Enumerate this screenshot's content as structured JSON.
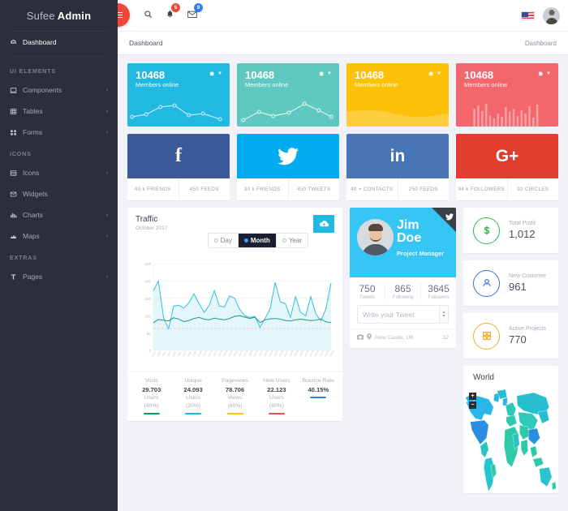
{
  "brand": {
    "light": "Sufee",
    "bold": "Admin"
  },
  "topbar": {
    "search_icon": "search-icon",
    "bell_badge": "5",
    "mail_badge": "9"
  },
  "breadcrumb": {
    "title": "Dashboard",
    "right": "Dashboard"
  },
  "sidebar": {
    "items": [
      {
        "label": "Dashboard",
        "icon": "dashboard-icon",
        "caret": "",
        "active": true
      }
    ],
    "sections": [
      {
        "heading": "UI ELEMENTS",
        "items": [
          {
            "label": "Components",
            "icon": "components-icon",
            "caret": "›"
          },
          {
            "label": "Tables",
            "icon": "tables-icon",
            "caret": "›"
          },
          {
            "label": "Forms",
            "icon": "forms-icon",
            "caret": "›"
          }
        ]
      },
      {
        "heading": "ICONS",
        "items": [
          {
            "label": "Icons",
            "icon": "icons-icon",
            "caret": "›"
          },
          {
            "label": "Widgets",
            "icon": "widgets-icon",
            "caret": ""
          },
          {
            "label": "Charts",
            "icon": "charts-icon",
            "caret": "›"
          },
          {
            "label": "Maps",
            "icon": "maps-icon",
            "caret": "›"
          }
        ]
      },
      {
        "heading": "EXTRAS",
        "items": [
          {
            "label": "Pages",
            "icon": "pages-icon",
            "caret": "›"
          }
        ]
      }
    ]
  },
  "stat_cards": [
    {
      "value": "10468",
      "label": "Members online",
      "color": "#21b9e2",
      "chart": "line-markers"
    },
    {
      "value": "10468",
      "label": "Members online",
      "color": "#5fc9bf",
      "chart": "line-markers"
    },
    {
      "value": "10468",
      "label": "Members online",
      "color": "#ffc107",
      "chart": "area"
    },
    {
      "value": "10468",
      "label": "Members online",
      "color": "#f3666d",
      "chart": "bars"
    }
  ],
  "social_cards": [
    {
      "network": "facebook",
      "glyph": "f",
      "color": "#3b5998",
      "stat1": "40 k FRIENDS",
      "stat2": "450 FEEDS"
    },
    {
      "network": "twitter",
      "glyph": "twitter-bird",
      "color": "#00aced",
      "stat1": "30 k FRIENDS",
      "stat2": "450 TWEETS"
    },
    {
      "network": "linkedin",
      "glyph": "in",
      "color": "#4875b4",
      "stat1": "40 + CONTACTS",
      "stat2": "250 FEEDS"
    },
    {
      "network": "googleplus",
      "glyph": "G+",
      "color": "#e03d2e",
      "stat1": "94 k FOLLOWERS",
      "stat2": "92 CIRCLES"
    }
  ],
  "traffic": {
    "title": "Traffic",
    "subtitle": "October 2017",
    "cloud_icon": "cloud-upload-icon",
    "ranges": [
      {
        "label": "Day",
        "selected": false
      },
      {
        "label": "Month",
        "selected": true
      },
      {
        "label": "Year",
        "selected": false
      }
    ],
    "metrics": [
      {
        "label": "Visits",
        "value": "29.703",
        "unit": "Users",
        "pct": "(40%)",
        "color": "#0f9d4f"
      },
      {
        "label": "Unique",
        "value": "24.093",
        "unit": "Users",
        "pct": "(20%)",
        "color": "#21b9e2"
      },
      {
        "label": "Pageviews",
        "value": "78.706",
        "unit": "Views",
        "pct": "(60%)",
        "color": "#ffc107"
      },
      {
        "label": "New Users",
        "value": "22.123",
        "unit": "Users",
        "pct": "(80%)",
        "color": "#e8505b"
      },
      {
        "label": "Bounce Rate",
        "value": "40.15%",
        "unit": "",
        "pct": "",
        "color": "#2d7ff0"
      }
    ]
  },
  "chart_data": {
    "type": "line",
    "title": "Traffic",
    "subtitle": "October 2017",
    "xlabel": "",
    "ylabel": "",
    "ylim": [
      0,
      250
    ],
    "yticks": [
      0,
      50,
      100,
      150,
      200,
      250
    ],
    "grid": true,
    "legend": "none",
    "threshold": {
      "value": 63,
      "style": "dashed",
      "color": "#f4b8c4"
    },
    "series": [
      {
        "name": "Visits",
        "color": "#31c0dd",
        "fill": "#dff4f8",
        "values": [
          172,
          200,
          95,
          62,
          128,
          130,
          122,
          137,
          163,
          135,
          110,
          130,
          172,
          128,
          125,
          157,
          150,
          118,
          100,
          95,
          98,
          67,
          92,
          120,
          196,
          140,
          135,
          95,
          155,
          110,
          100,
          155,
          105,
          85,
          120,
          195
        ]
      },
      {
        "name": "Unique",
        "color": "#2f9e8f",
        "fill": "none",
        "values": [
          80,
          89,
          87,
          85,
          94,
          90,
          83,
          86,
          92,
          95,
          90,
          88,
          93,
          90,
          88,
          92,
          98,
          100,
          96,
          92,
          96,
          80,
          88,
          91,
          92,
          90,
          86,
          85,
          88,
          90,
          88,
          86,
          87,
          91,
          82,
          80
        ]
      }
    ]
  },
  "profile": {
    "first_name": "Jim",
    "last_name": "Doe",
    "role": "Project Manager",
    "corner_icon": "twitter-icon",
    "stats": [
      {
        "value": "750",
        "label": "Tweets"
      },
      {
        "value": "865",
        "label": "Following"
      },
      {
        "value": "3645",
        "label": "Followers"
      }
    ],
    "tweet_placeholder": "Write your Tweet",
    "location": "New Castle, UK",
    "count": "32",
    "camera_icon": "camera-icon",
    "pin_icon": "location-pin-icon"
  },
  "metric_cards": [
    {
      "icon": "dollar-icon",
      "label": "Total Profit",
      "value": "1,012",
      "color": "#2db84d"
    },
    {
      "icon": "user-icon",
      "label": "New Customer",
      "value": "961",
      "color": "#3a6fd8"
    },
    {
      "icon": "grid-icon",
      "label": "Active Projects",
      "value": "770",
      "color": "#f0ad2e"
    }
  ],
  "world": {
    "title": "World",
    "zoom_in": "+",
    "zoom_out": "−"
  }
}
